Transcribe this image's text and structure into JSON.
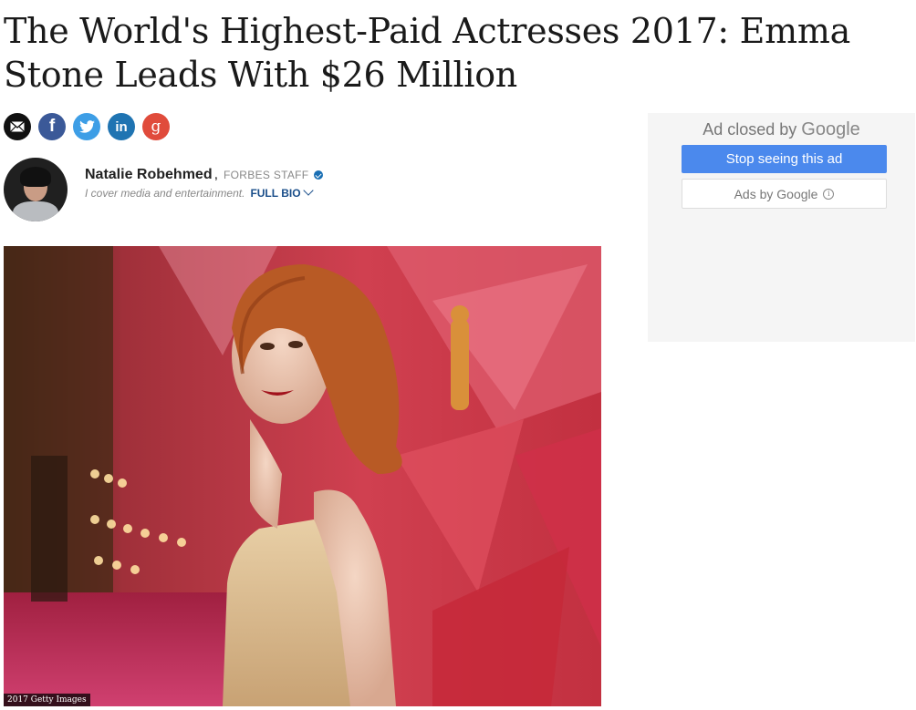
{
  "article": {
    "headline": "The World's Highest-Paid Actresses 2017: Emma Stone Leads With $26 Million"
  },
  "share": {
    "icons": [
      "email-icon",
      "facebook-icon",
      "twitter-icon",
      "linkedin-icon",
      "google-plus-icon"
    ],
    "facebook_glyph": "f",
    "linkedin_glyph": "in",
    "google_glyph": "g"
  },
  "author": {
    "name": "Natalie Robehmed",
    "separator": ",",
    "role": "FORBES STAFF",
    "bio": "I cover media and entertainment.",
    "full_bio_label": "FULL BIO"
  },
  "hero_image": {
    "credit": "2017 Getty Images"
  },
  "ad": {
    "closed_prefix": "Ad closed by",
    "closed_brand": "Google",
    "stop_button_label": "Stop seeing this ad",
    "ads_by_label": "Ads by Google",
    "info_glyph": "i"
  },
  "colors": {
    "facebook": "#3b5998",
    "twitter": "#3d9ee6",
    "linkedin": "#1f74b2",
    "google": "#e04b3b",
    "ad_button": "#4b89ed",
    "full_bio": "#1a4e8a"
  }
}
